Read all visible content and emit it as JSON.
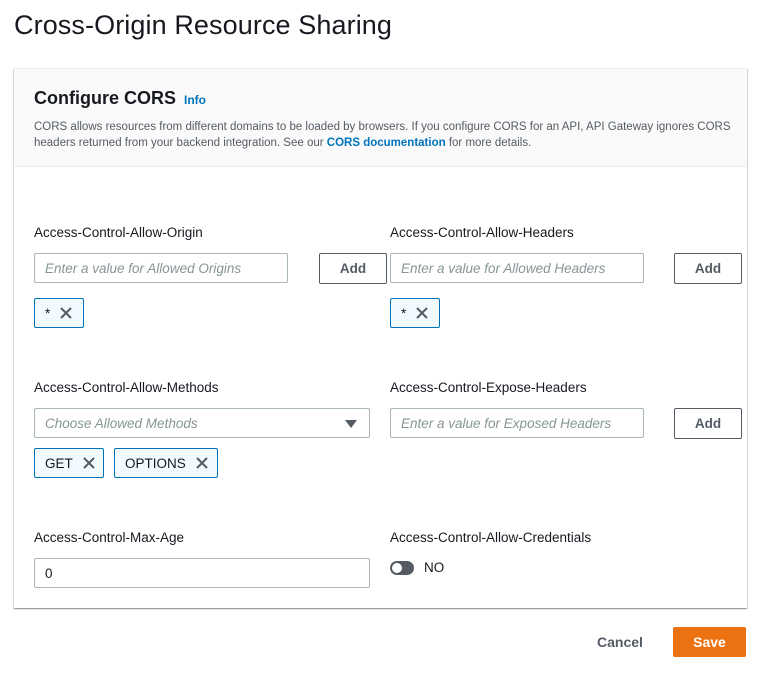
{
  "page": {
    "title": "Cross-Origin Resource Sharing"
  },
  "panel": {
    "title": "Configure CORS",
    "info_label": "Info",
    "desc_before": "CORS allows resources from different domains to be loaded by browsers. If you configure CORS for an API, API Gateway ignores CORS headers returned from your backend integration. See our ",
    "desc_link": "CORS documentation",
    "desc_after": " for more details."
  },
  "allow_origin": {
    "label": "Access-Control-Allow-Origin",
    "placeholder": "Enter a value for Allowed Origins",
    "add_label": "Add",
    "tokens": [
      "*"
    ]
  },
  "allow_headers": {
    "label": "Access-Control-Allow-Headers",
    "placeholder": "Enter a value for Allowed Headers",
    "add_label": "Add",
    "tokens": [
      "*"
    ]
  },
  "allow_methods": {
    "label": "Access-Control-Allow-Methods",
    "placeholder": "Choose Allowed Methods",
    "tokens": [
      "GET",
      "OPTIONS"
    ]
  },
  "expose_headers": {
    "label": "Access-Control-Expose-Headers",
    "placeholder": "Enter a value for Exposed Headers",
    "add_label": "Add"
  },
  "max_age": {
    "label": "Access-Control-Max-Age",
    "value": "0"
  },
  "allow_credentials": {
    "label": "Access-Control-Allow-Credentials",
    "state_label": "NO"
  },
  "footer": {
    "cancel_label": "Cancel",
    "save_label": "Save"
  },
  "icons": {
    "token_remove": "close-icon",
    "select_caret": "caret-down-icon"
  },
  "colors": {
    "link": "#0073bb",
    "primary_button": "#ec7211",
    "token_border": "#0073bb",
    "token_bg": "#f1faff"
  }
}
